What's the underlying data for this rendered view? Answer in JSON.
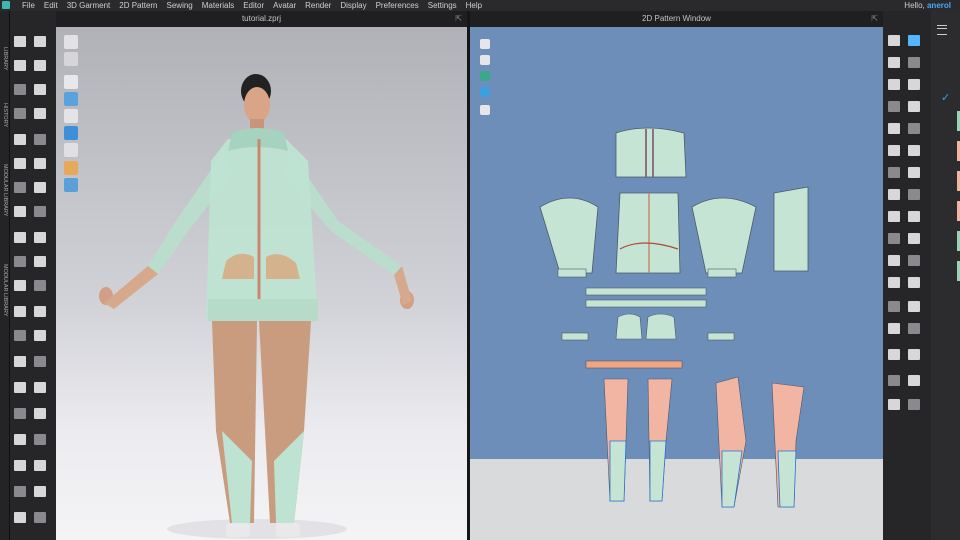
{
  "menubar": {
    "items": [
      "File",
      "Edit",
      "3D Garment",
      "2D Pattern",
      "Sewing",
      "Materials",
      "Editor",
      "Avatar",
      "Render",
      "Display",
      "Preferences",
      "Settings",
      "Help"
    ],
    "greeting": "Hello,",
    "username": "anerol"
  },
  "side_tabs": [
    "LIBRARY",
    "HISTORY",
    "MODULAR LIBRARY",
    "MODULAR LIBRARY"
  ],
  "viewport_3d": {
    "title": "tutorial.zprj"
  },
  "viewport_2d": {
    "title": "2D Pattern Window"
  },
  "colors": {
    "background_3d": "#d1d2d7",
    "background_2d": "#6e8eba",
    "pattern_green": "#c5e4d4",
    "pattern_salmon": "#f2b4a3",
    "accent": "#4aa6ff",
    "check": "#3aa0e8"
  },
  "icons": {
    "close": "close-icon",
    "check": "check-icon",
    "hamburger": "hamburger-icon",
    "maximize": "maximize-icon"
  }
}
